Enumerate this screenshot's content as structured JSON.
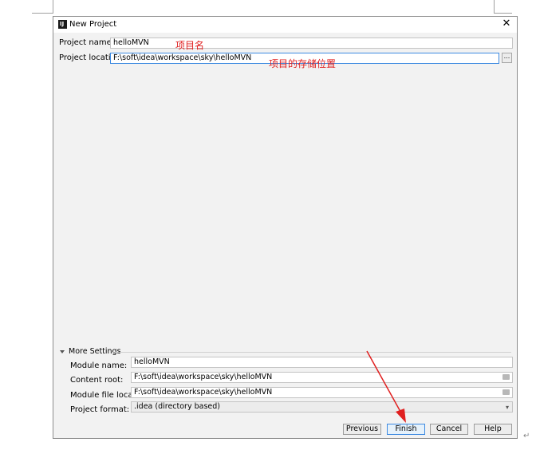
{
  "window": {
    "title": "New Project",
    "app_icon": "IJ"
  },
  "project": {
    "name_label": "Project name:",
    "name_value": "helloMVN",
    "location_label": "Project location:",
    "location_value": "F:\\soft\\idea\\workspace\\sky\\helloMVN",
    "browse_label": "..."
  },
  "annotations": {
    "name_note": "项目名",
    "location_note": "项目的存储位置",
    "arrow_color": "#e02020"
  },
  "more_settings": {
    "header": "More Settings",
    "module_name_label": "Module name:",
    "module_name_value": "helloMVN",
    "content_root_label": "Content root:",
    "content_root_value": "F:\\soft\\idea\\workspace\\sky\\helloMVN",
    "module_file_label": "Module file location:",
    "module_file_value": "F:\\soft\\idea\\workspace\\sky\\helloMVN",
    "format_label": "Project format:",
    "format_value": ".idea (directory based)"
  },
  "buttons": {
    "previous": "Previous",
    "finish": "Finish",
    "cancel": "Cancel",
    "help": "Help"
  },
  "colors": {
    "accent": "#3d8ae1",
    "dialog_bg": "#f2f2f2",
    "annotation": "#e02020"
  }
}
